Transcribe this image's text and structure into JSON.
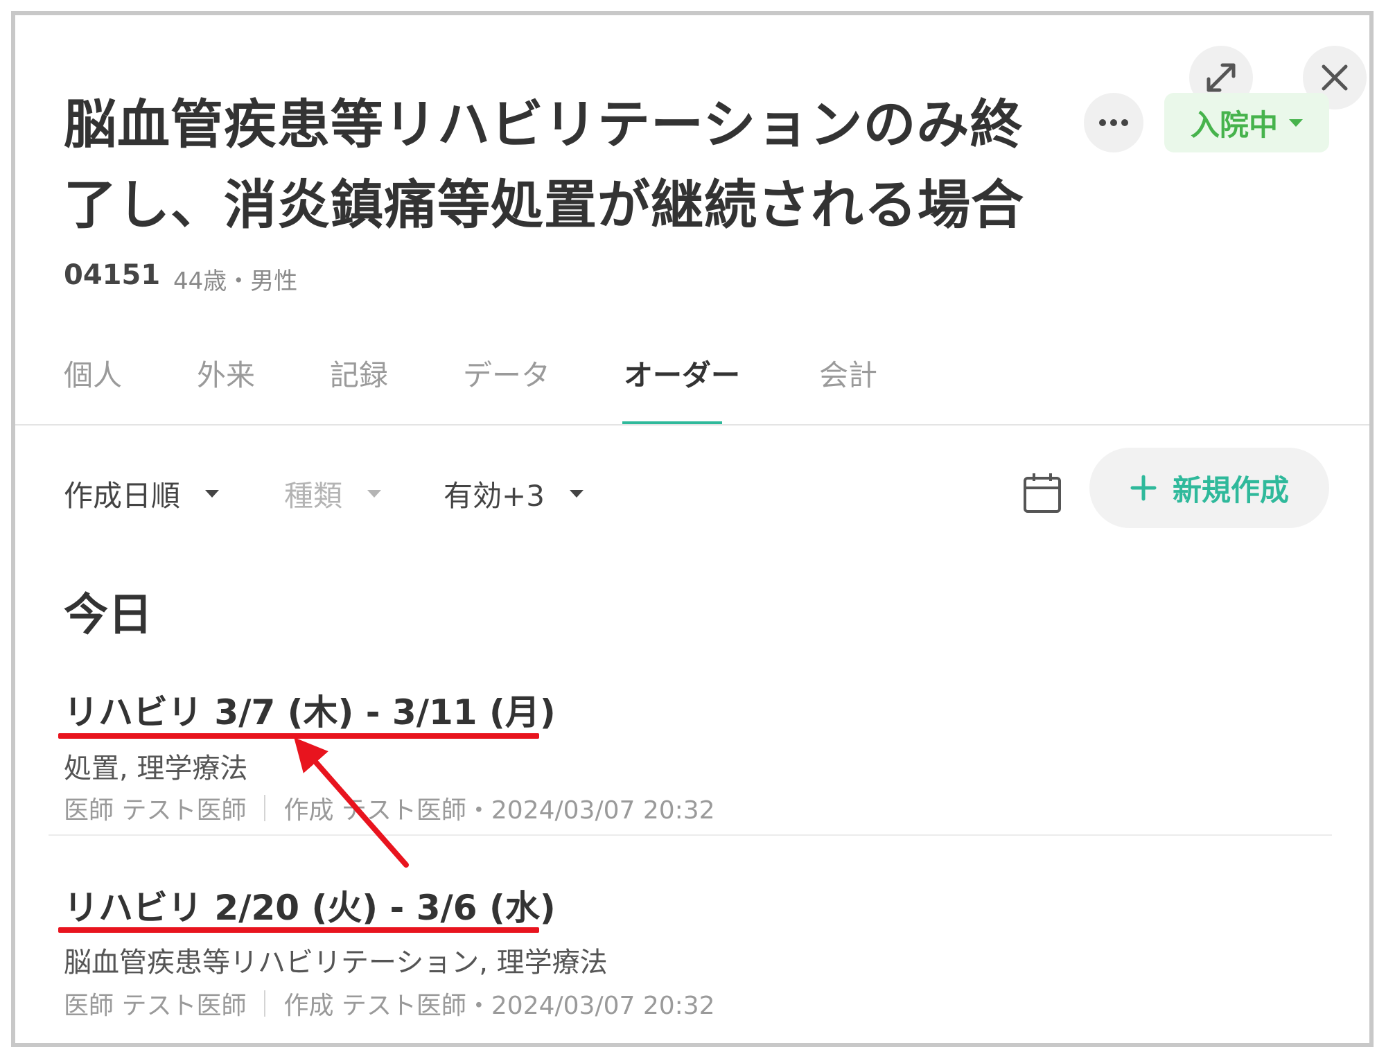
{
  "header": {
    "title": "脳血管疾患等リハビリテーションのみ終了し、消炎鎮痛等処置が継続される場合",
    "patient_id": "04151",
    "patient_info": "44歳・男性",
    "status_label": "入院中",
    "status_color": "#46b34c",
    "icons": {
      "expand": "expand-arrows-icon",
      "close": "close-icon",
      "more": "more-horizontal-icon"
    }
  },
  "tabs": [
    {
      "label": "個人"
    },
    {
      "label": "外来"
    },
    {
      "label": "記録"
    },
    {
      "label": "データ"
    },
    {
      "label": "オーダー",
      "active": true
    },
    {
      "label": "会計"
    }
  ],
  "filters": {
    "sort": "作成日順",
    "type": "種類",
    "validity": "有効+3",
    "new_button": "新規作成"
  },
  "section_label": "今日",
  "orders": [
    {
      "title": "リハビリ  3/7 (木) - 3/11 (月)",
      "subtitle": "処置, 理学療法",
      "doctor": "医師 テスト医師",
      "created": "作成 テスト医師・2024/03/07 20:32"
    },
    {
      "title": "リハビリ  2/20 (火) - 3/6 (水)",
      "subtitle": "脳血管疾患等リハビリテーション, 理学療法",
      "doctor": "医師 テスト医師",
      "created": "作成 テスト医師・2024/03/07 20:32"
    }
  ],
  "colors": {
    "accent": "#2fb99b",
    "annotation": "#e8141e"
  }
}
